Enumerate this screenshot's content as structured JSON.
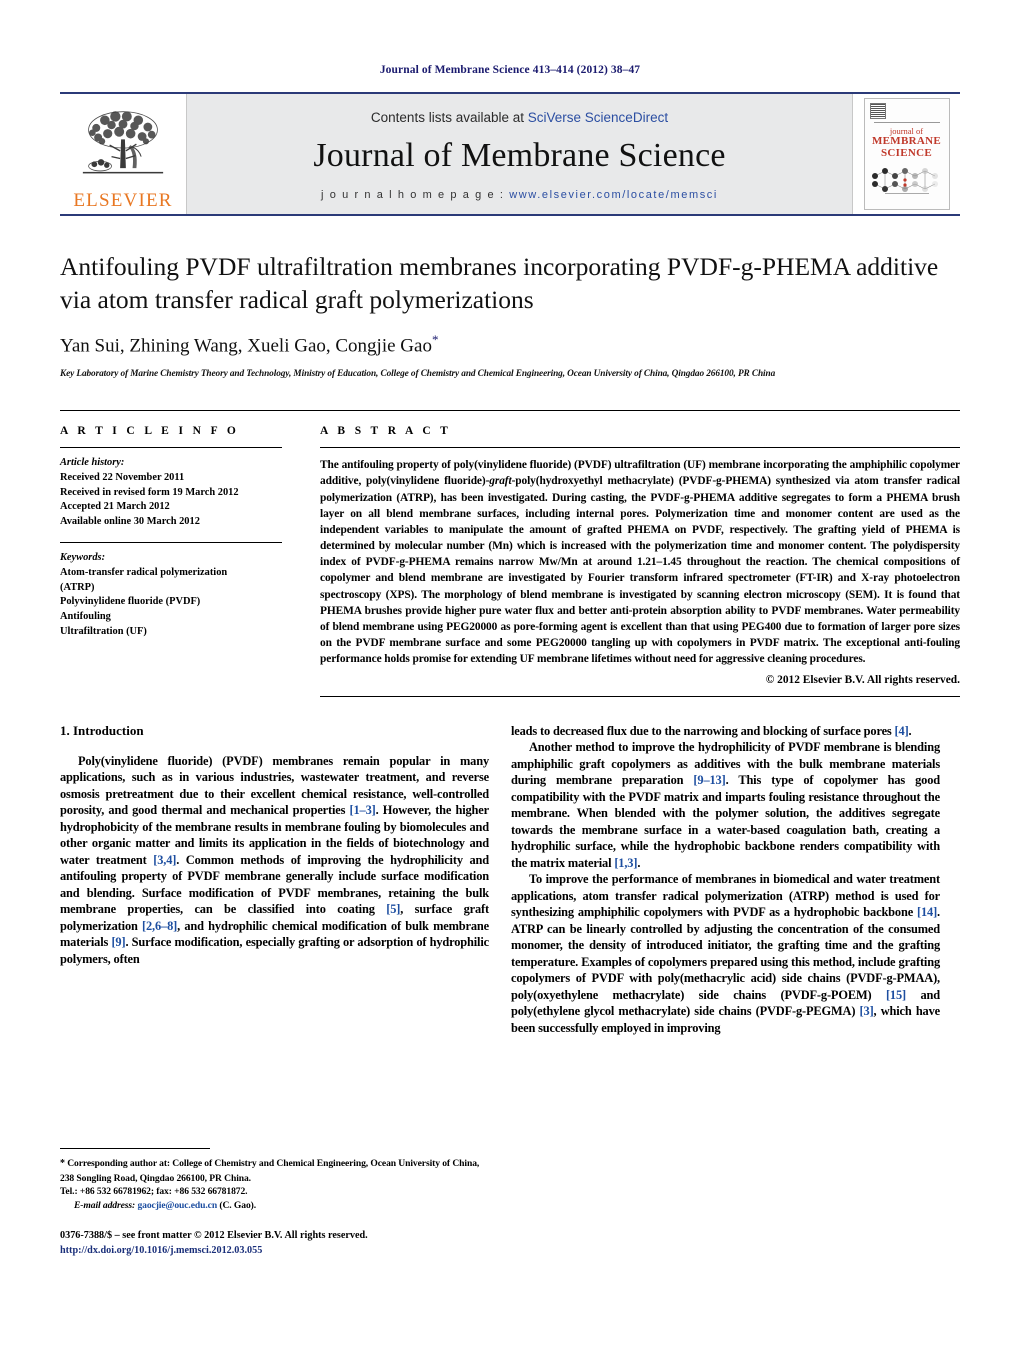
{
  "running_head": "Journal of Membrane Science 413–414 (2012) 38–47",
  "masthead": {
    "publisher_name": "ELSEVIER",
    "contents_prefix": "Contents lists available at",
    "contents_link": "SciVerse ScienceDirect",
    "journal_title": "Journal of Membrane Science",
    "homepage_label": "j o u r n a l   h o m e p a g e :",
    "homepage_url": "www.elsevier.com/locate/memsci",
    "cover": {
      "line1": "journal of",
      "line2": "MEMBRANE",
      "line3": "SCIENCE"
    }
  },
  "article": {
    "title": "Antifouling PVDF ultrafiltration membranes incorporating PVDF-g-PHEMA additive via atom transfer radical graft polymerizations",
    "authors": "Yan Sui, Zhining Wang, Xueli Gao, Congjie Gao",
    "corresponding_marker": "*",
    "affiliation": "Key Laboratory of Marine Chemistry Theory and Technology, Ministry of Education, College of Chemistry and Chemical Engineering, Ocean University of China, Qingdao 266100, PR China"
  },
  "article_info": {
    "heading": "A R T I C L E   I N F O",
    "history_label": "Article history:",
    "history": [
      "Received 22 November 2011",
      "Received in revised form 19 March 2012",
      "Accepted 21 March 2012",
      "Available online 30 March 2012"
    ],
    "keywords_label": "Keywords:",
    "keywords": [
      "Atom-transfer radical polymerization",
      "(ATRP)",
      "Polyvinylidene fluoride (PVDF)",
      "Antifouling",
      "Ultrafiltration (UF)"
    ]
  },
  "abstract": {
    "heading": "A B S T R A C T",
    "text_part1": "The antifouling property of poly(vinylidene fluoride) (PVDF) ultrafiltration (UF) membrane incorporating the amphiphilic copolymer additive, poly(vinylidene fluoride)-",
    "graft_italic": "graft",
    "text_part2": "-poly(hydroxyethyl methacrylate) (PVDF-g-PHEMA) synthesized via atom transfer radical polymerization (ATRP), has been investigated. During casting, the PVDF-g-PHEMA additive segregates to form a PHEMA brush layer on all blend membrane surfaces, including internal pores. Polymerization time and monomer content are used as the independent variables to manipulate the amount of grafted PHEMA on PVDF, respectively. The grafting yield of PHEMA is determined by molecular number (Mn) which is increased with the polymerization time and monomer content. The polydispersity index of PVDF-g-PHEMA remains narrow Mw/Mn at around 1.21–1.45 throughout the reaction. The chemical compositions of copolymer and blend membrane are investigated by Fourier transform infrared spectrometer (FT-IR) and X-ray photoelectron spectroscopy (XPS). The morphology of blend membrane is investigated by scanning electron microscopy (SEM). It is found that PHEMA brushes provide higher pure water flux and better anti-protein absorption ability to PVDF membranes. Water permeability of blend membrane using PEG20000 as pore-forming agent is excellent than that using PEG400 due to formation of larger pore sizes on the PVDF membrane surface and some PEG20000 tangling up with copolymers in PVDF matrix. The exceptional anti-fouling performance holds promise for extending UF membrane lifetimes without need for aggressive cleaning procedures.",
    "copyright": "© 2012 Elsevier B.V. All rights reserved."
  },
  "body": {
    "section_number_title": "1.  Introduction",
    "left_paragraphs": [
      {
        "segments": [
          {
            "t": "Poly(vinylidene fluoride) (PVDF) membranes remain popular in many applications, such as in various industries, wastewater treatment, and reverse osmosis pretreatment due to their excellent chemical resistance, well-controlled porosity, and good thermal and mechanical properties "
          },
          {
            "t": "[1–3]",
            "cite": true
          },
          {
            "t": ". However, the higher hydrophobicity of the membrane results in membrane fouling by biomolecules and other organic matter and limits its application in the fields of biotechnology and water treatment "
          },
          {
            "t": "[3,4]",
            "cite": true
          },
          {
            "t": ". Common methods of improving the hydrophilicity and antifouling property of PVDF membrane generally include surface modification and blending. Surface modification of PVDF membranes, retaining the bulk membrane properties, can be classified into coating "
          },
          {
            "t": "[5]",
            "cite": true
          },
          {
            "t": ", surface graft polymerization "
          },
          {
            "t": "[2,6–8]",
            "cite": true
          },
          {
            "t": ", and hydrophilic chemical modification of bulk membrane materials "
          },
          {
            "t": "[9]",
            "cite": true
          },
          {
            "t": ". Surface modification, especially grafting or adsorption of hydrophilic polymers, often"
          }
        ]
      }
    ],
    "right_paragraphs": [
      {
        "indent": false,
        "segments": [
          {
            "t": "leads to decreased flux due to the narrowing and blocking of surface pores "
          },
          {
            "t": "[4]",
            "cite": true
          },
          {
            "t": "."
          }
        ]
      },
      {
        "indent": true,
        "segments": [
          {
            "t": "Another method to improve the hydrophilicity of PVDF membrane is blending amphiphilic graft copolymers as additives with the bulk membrane materials during membrane preparation "
          },
          {
            "t": "[9–13]",
            "cite": true
          },
          {
            "t": ". This type of copolymer has good compatibility with the PVDF matrix and imparts fouling resistance throughout the membrane. When blended with the polymer solution, the additives segregate towards the membrane surface in a water-based coagulation bath, creating a hydrophilic surface, while the hydrophobic backbone renders compatibility with the matrix material "
          },
          {
            "t": "[1,3]",
            "cite": true
          },
          {
            "t": "."
          }
        ]
      },
      {
        "indent": true,
        "segments": [
          {
            "t": "To improve the performance of membranes in biomedical and water treatment applications, atom transfer radical polymerization (ATRP) method is used for synthesizing amphiphilic copolymers with PVDF as a hydrophobic backbone "
          },
          {
            "t": "[14]",
            "cite": true
          },
          {
            "t": ". ATRP can be linearly controlled by adjusting the concentration of the consumed monomer, the density of introduced initiator, the grafting time and the grafting temperature. Examples of copolymers prepared using this method, include grafting copolymers of PVDF with poly(methacrylic acid) side chains (PVDF-g-PMAA), poly(oxyethylene methacrylate) side chains (PVDF-g-POEM) "
          },
          {
            "t": "[15]",
            "cite": true
          },
          {
            "t": " and poly(ethylene glycol methacrylate) side chains (PVDF-g-PEGMA) "
          },
          {
            "t": "[3]",
            "cite": true
          },
          {
            "t": ", which have been successfully employed in improving"
          }
        ]
      }
    ]
  },
  "footnote": {
    "star": "*",
    "corresponding": "Corresponding author at: College of Chemistry and Chemical Engineering, Ocean University of China, 238 Songling Road, Qingdao 266100, PR China.",
    "tel_fax": "Tel.: +86 532 66781962; fax: +86 532 66781872.",
    "email_label": "E-mail address:",
    "email": "gaocjie@ouc.edu.cn",
    "email_owner": "(C. Gao)."
  },
  "imprint": {
    "line1": "0376-7388/$ – see front matter © 2012 Elsevier B.V. All rights reserved.",
    "doi": "http://dx.doi.org/10.1016/j.memsci.2012.03.055"
  },
  "colors": {
    "link_blue": "#2b4ea2",
    "cite_blue": "#1d4ea0",
    "elsevier_orange": "#E87722",
    "cover_red": "#c0392b",
    "masthead_rule": "#2b3a78"
  }
}
